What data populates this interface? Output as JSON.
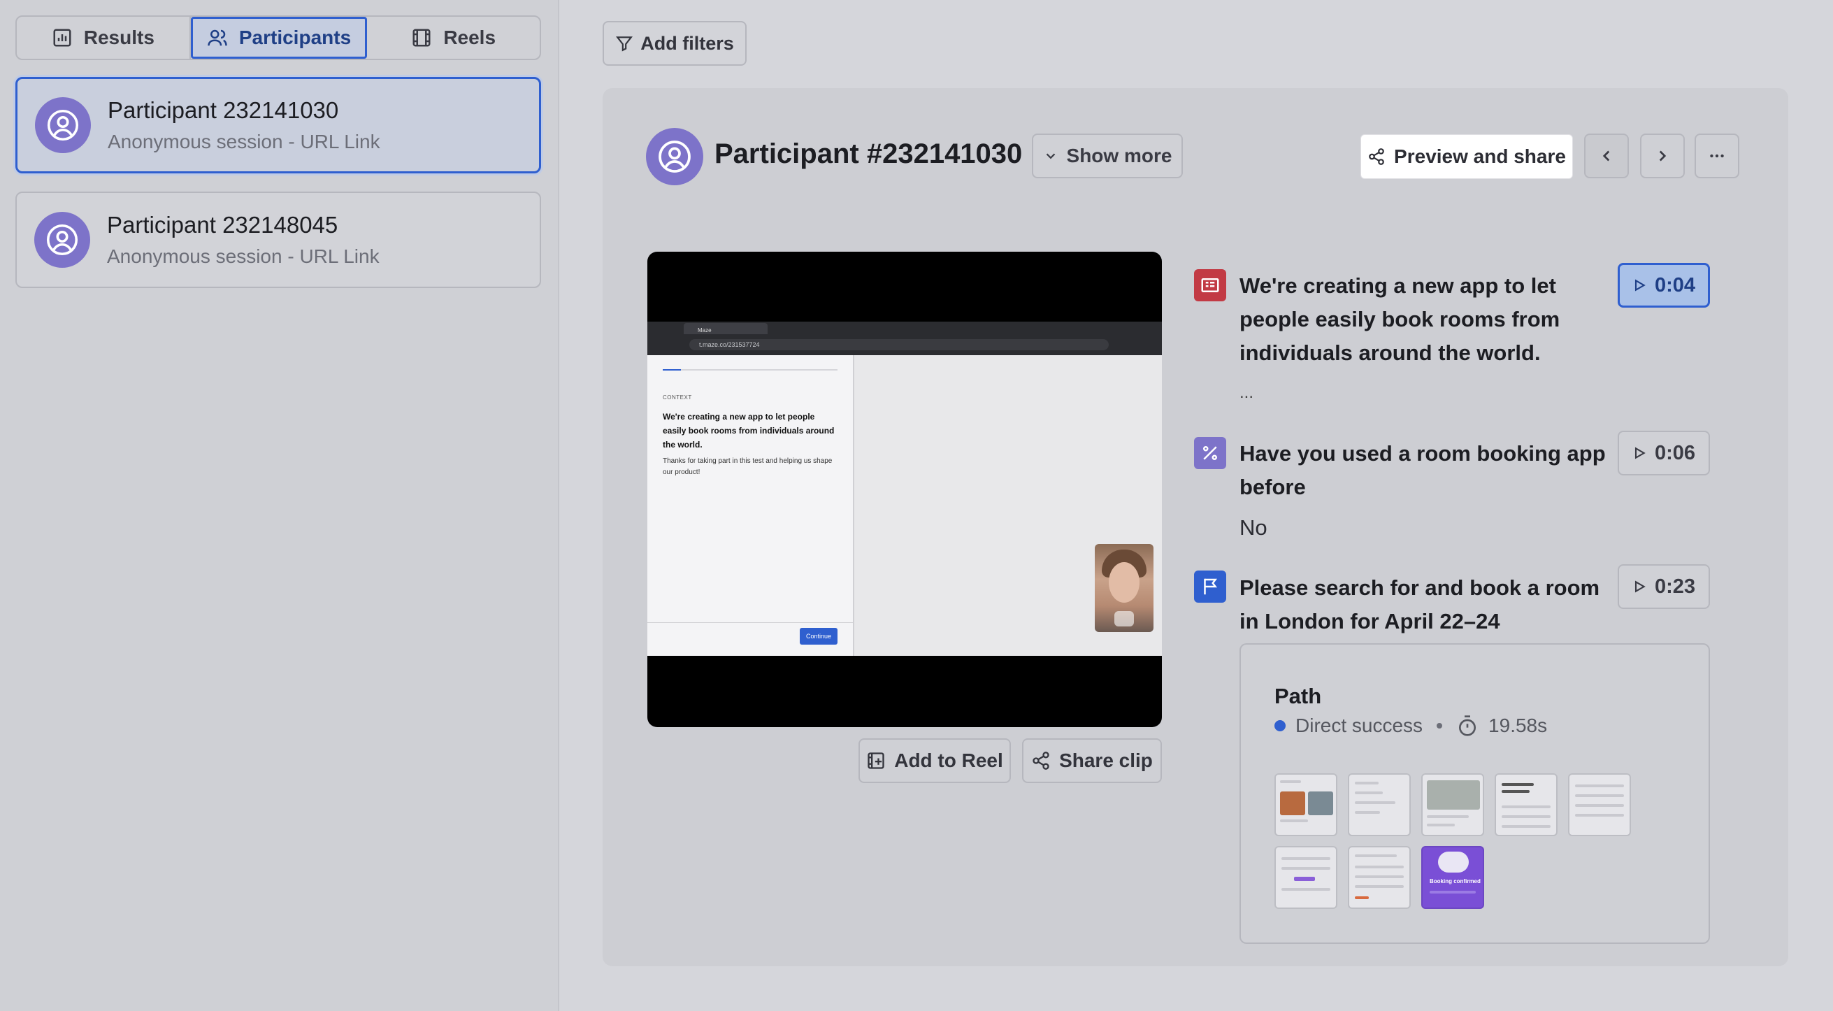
{
  "sidebar": {
    "tabs": [
      {
        "label": "Results",
        "icon": "bar-chart-icon"
      },
      {
        "label": "Participants",
        "icon": "users-icon",
        "active": true
      },
      {
        "label": "Reels",
        "icon": "film-icon"
      }
    ],
    "participants": [
      {
        "name": "Participant 232141030",
        "session": "Anonymous session - URL Link",
        "active": true
      },
      {
        "name": "Participant 232148045",
        "session": "Anonymous session - URL Link",
        "active": false
      }
    ]
  },
  "toolbar": {
    "add_filters_label": "Add filters"
  },
  "header": {
    "title": "Participant #232141030",
    "show_more_label": "Show more",
    "preview_share_label": "Preview and share"
  },
  "video": {
    "url": "t.maze.co/231537724",
    "tab_label": "Maze",
    "screen_context": "CONTEXT",
    "screen_heading": "We're creating a new app to let people easily book rooms from individuals around the world.",
    "screen_body": "Thanks for taking part in this test and helping us shape our product!",
    "screen_button": "Continue",
    "add_to_reel_label": "Add to Reel",
    "share_clip_label": "Share clip"
  },
  "questions": [
    {
      "text": "We're creating a new app to let people easily book rooms from individuals around the world.",
      "time": "0:04",
      "icon": "context-block-icon",
      "color": "#c23a44",
      "answer": "...",
      "active": true
    },
    {
      "text": "Have you used a room booking app before",
      "time": "0:06",
      "icon": "yes-no-icon",
      "color": "#7d73c9",
      "answer": "No"
    },
    {
      "text": "Please search for and book a room in London for April 22–24",
      "time": "0:23",
      "icon": "mission-flag-icon",
      "color": "#2f5fcf"
    }
  ],
  "path": {
    "title": "Path",
    "status": "Direct success",
    "duration": "19.58s",
    "status_color": "#2f5fcf",
    "booking_confirmed_label": "Booking confirmed"
  }
}
